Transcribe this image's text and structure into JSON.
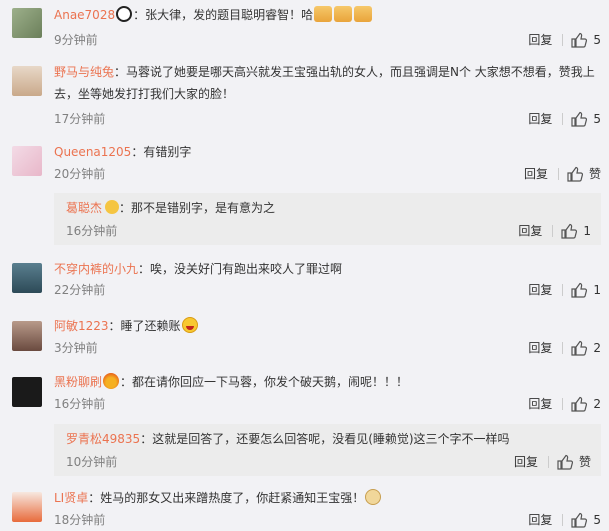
{
  "labels": {
    "reply": "回复",
    "like": "赞"
  },
  "comments": [
    {
      "user": "Anae7028",
      "body": "：张大律，发的题目聪明睿智！哈",
      "time": "9分钟前",
      "likes": "5"
    },
    {
      "user": "野马与纯兔",
      "body": "：马蓉说了她要是哪天高兴就发王宝强出轨的女人，而且强调是N个 大家想不想看，赞我上去，坐等她发打打我们大家的脸！",
      "time": "17分钟前",
      "likes": "5"
    },
    {
      "user": "Queena1205",
      "body": "：有错别字",
      "time": "20分钟前",
      "likes": "赞"
    },
    {
      "user": "不穿内裤的小九",
      "body": "：唉，没关好门有跑出来咬人了罪过啊",
      "time": "22分钟前",
      "likes": "1"
    },
    {
      "user": "阿敏1223",
      "body": "：睡了还赖账",
      "time": "3分钟前",
      "likes": "2"
    },
    {
      "user": "黑粉聊刷",
      "body": "：都在请你回应一下马蓉，你发个破天鹅，闹呢！！！",
      "time": "16分钟前",
      "likes": "2"
    },
    {
      "user": "LI贤卓",
      "body": "：姓马的那女又出来蹭热度了，你赶紧通知王宝强！",
      "time": "18分钟前",
      "likes": "5"
    }
  ],
  "subreplies": [
    {
      "user": "葛聪杰",
      "body": "：那不是错别字，是有意为之",
      "time": "16分钟前",
      "likes": "1"
    },
    {
      "user": "罗青松49835",
      "body": "：这就是回答了，还要怎么回答呢，没看见(睡赖觉)这三个字不一样吗",
      "time": "10分钟前",
      "likes": "赞"
    }
  ]
}
